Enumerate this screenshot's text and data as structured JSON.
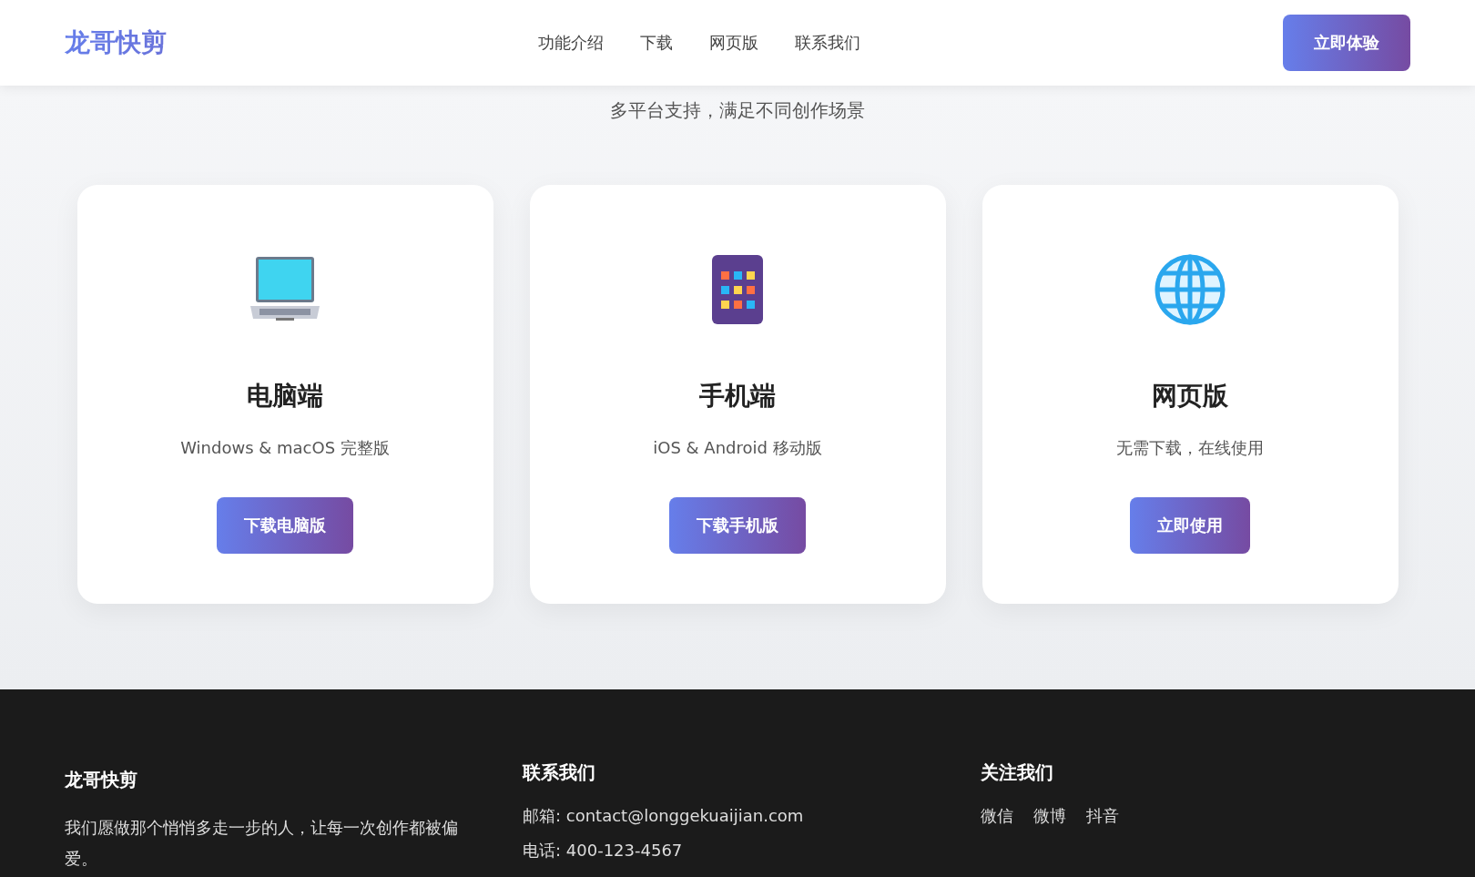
{
  "header": {
    "logo": "龙哥快剪",
    "nav": [
      "功能介绍",
      "下载",
      "网页版",
      "联系我们"
    ],
    "cta": "立即体验"
  },
  "download": {
    "subtitle": "多平台支持，满足不同创作场景",
    "cards": [
      {
        "kind": "desktop",
        "title": "电脑端",
        "description": "Windows & macOS 完整版",
        "button": "下载电脑版"
      },
      {
        "kind": "mobile",
        "title": "手机端",
        "description": "iOS & Android 移动版",
        "button": "下载手机版"
      },
      {
        "kind": "web",
        "title": "网页版",
        "description": "无需下载，在线使用",
        "button": "立即使用"
      }
    ]
  },
  "footer": {
    "brand": {
      "title": "龙哥快剪",
      "text": "我们愿做那个悄悄多走一步的人，让每一次创作都被偏爱。"
    },
    "contact": {
      "title": "联系我们",
      "lines": [
        "邮箱: contact@longgekuaijian.com",
        "电话: 400-123-4567"
      ]
    },
    "follow": {
      "title": "关注我们",
      "links": [
        "微信",
        "微博",
        "抖音"
      ]
    }
  }
}
